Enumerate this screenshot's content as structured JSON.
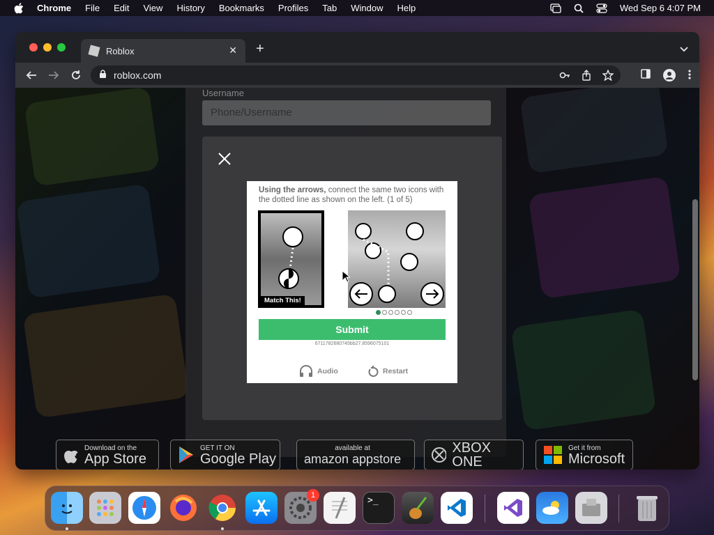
{
  "menubar": {
    "app_name": "Chrome",
    "items": [
      "File",
      "Edit",
      "View",
      "History",
      "Bookmarks",
      "Profiles",
      "Tab",
      "Window",
      "Help"
    ],
    "clock": "Wed Sep 6  4:07 PM"
  },
  "browser": {
    "tab_title": "Roblox",
    "url": "roblox.com"
  },
  "page": {
    "username_label": "Username",
    "username_placeholder": "Phone/Username"
  },
  "captcha": {
    "instruction_bold": "Using the arrows,",
    "instruction_rest": " connect the same two icons with the dotted line as shown on the left. (1 of 5)",
    "match_label": "Match This!",
    "submit_label": "Submit",
    "session_id": "6711782680745bb27.8596075101",
    "audio_label": "Audio",
    "restart_label": "Restart",
    "progress": {
      "current": 1,
      "total": 6
    }
  },
  "stores": [
    {
      "small": "Download on the",
      "big": "App Store"
    },
    {
      "small": "GET IT ON",
      "big": "Google Play"
    },
    {
      "small": "available at",
      "big": "amazon appstore"
    },
    {
      "small": "",
      "big": "XBOX ONE"
    },
    {
      "small": "Get it from",
      "big": "Microsoft"
    }
  ],
  "dock": {
    "settings_badge": "1"
  },
  "colors": {
    "submit_green": "#3cbd6e",
    "chrome_dark": "#35363a",
    "badge_red": "#ff3b30"
  }
}
